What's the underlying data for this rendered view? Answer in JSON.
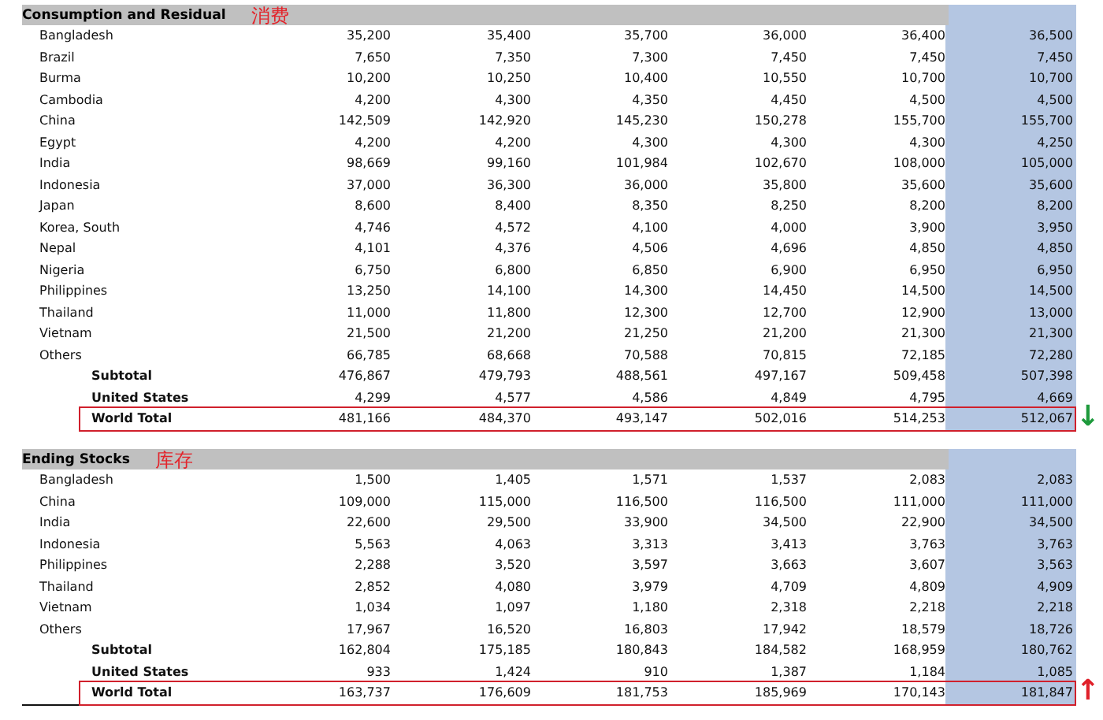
{
  "columns": [
    {
      "shaded": false
    },
    {
      "shaded": false
    },
    {
      "shaded": false
    },
    {
      "shaded": false
    },
    {
      "shaded": false
    },
    {
      "shaded": true
    }
  ],
  "sections": [
    {
      "title": "Consumption and Residual",
      "annotation": "消费",
      "arrow": {
        "glyph": "↓",
        "color": "#1e9a3c"
      },
      "rows": [
        {
          "kind": "country",
          "name": "Bangladesh",
          "boxed": false,
          "values": [
            "35,200",
            "35,400",
            "35,700",
            "36,000",
            "36,400",
            "36,500"
          ]
        },
        {
          "kind": "country",
          "name": "Brazil",
          "boxed": false,
          "values": [
            "7,650",
            "7,350",
            "7,300",
            "7,450",
            "7,450",
            "7,450"
          ]
        },
        {
          "kind": "country",
          "name": "Burma",
          "boxed": false,
          "values": [
            "10,200",
            "10,250",
            "10,400",
            "10,550",
            "10,700",
            "10,700"
          ]
        },
        {
          "kind": "country",
          "name": "Cambodia",
          "boxed": false,
          "values": [
            "4,200",
            "4,300",
            "4,350",
            "4,450",
            "4,500",
            "4,500"
          ]
        },
        {
          "kind": "country",
          "name": "China",
          "boxed": false,
          "values": [
            "142,509",
            "142,920",
            "145,230",
            "150,278",
            "155,700",
            "155,700"
          ]
        },
        {
          "kind": "country",
          "name": "Egypt",
          "boxed": false,
          "values": [
            "4,200",
            "4,200",
            "4,300",
            "4,300",
            "4,300",
            "4,250"
          ]
        },
        {
          "kind": "country",
          "name": "India",
          "boxed": false,
          "values": [
            "98,669",
            "99,160",
            "101,984",
            "102,670",
            "108,000",
            "105,000"
          ]
        },
        {
          "kind": "country",
          "name": "Indonesia",
          "boxed": false,
          "values": [
            "37,000",
            "36,300",
            "36,000",
            "35,800",
            "35,600",
            "35,600"
          ]
        },
        {
          "kind": "country",
          "name": "Japan",
          "boxed": false,
          "values": [
            "8,600",
            "8,400",
            "8,350",
            "8,250",
            "8,200",
            "8,200"
          ]
        },
        {
          "kind": "country",
          "name": "Korea, South",
          "boxed": false,
          "values": [
            "4,746",
            "4,572",
            "4,100",
            "4,000",
            "3,900",
            "3,950"
          ]
        },
        {
          "kind": "country",
          "name": "Nepal",
          "boxed": false,
          "values": [
            "4,101",
            "4,376",
            "4,506",
            "4,696",
            "4,850",
            "4,850"
          ]
        },
        {
          "kind": "country",
          "name": "Nigeria",
          "boxed": false,
          "values": [
            "6,750",
            "6,800",
            "6,850",
            "6,900",
            "6,950",
            "6,950"
          ]
        },
        {
          "kind": "country",
          "name": "Philippines",
          "boxed": false,
          "values": [
            "13,250",
            "14,100",
            "14,300",
            "14,450",
            "14,500",
            "14,500"
          ]
        },
        {
          "kind": "country",
          "name": "Thailand",
          "boxed": false,
          "values": [
            "11,000",
            "11,800",
            "12,300",
            "12,700",
            "12,900",
            "13,000"
          ]
        },
        {
          "kind": "country",
          "name": "Vietnam",
          "boxed": false,
          "values": [
            "21,500",
            "21,200",
            "21,250",
            "21,200",
            "21,300",
            "21,300"
          ]
        },
        {
          "kind": "country",
          "name": "Others",
          "boxed": false,
          "values": [
            "66,785",
            "68,668",
            "70,588",
            "70,815",
            "72,185",
            "72,280"
          ]
        },
        {
          "kind": "total",
          "name": "Subtotal",
          "boxed": false,
          "values": [
            "476,867",
            "479,793",
            "488,561",
            "497,167",
            "509,458",
            "507,398"
          ]
        },
        {
          "kind": "total",
          "name": "United States",
          "boxed": false,
          "values": [
            "4,299",
            "4,577",
            "4,586",
            "4,849",
            "4,795",
            "4,669"
          ]
        },
        {
          "kind": "total",
          "name": "World Total",
          "boxed": true,
          "values": [
            "481,166",
            "484,370",
            "493,147",
            "502,016",
            "514,253",
            "512,067"
          ]
        }
      ]
    },
    {
      "title": "Ending Stocks",
      "annotation": "库存",
      "arrow": {
        "glyph": "↑",
        "color": "#e0202a"
      },
      "rows": [
        {
          "kind": "country",
          "name": "Bangladesh",
          "boxed": false,
          "values": [
            "1,500",
            "1,405",
            "1,571",
            "1,537",
            "2,083",
            "2,083"
          ]
        },
        {
          "kind": "country",
          "name": "China",
          "boxed": false,
          "values": [
            "109,000",
            "115,000",
            "116,500",
            "116,500",
            "111,000",
            "111,000"
          ]
        },
        {
          "kind": "country",
          "name": "India",
          "boxed": false,
          "values": [
            "22,600",
            "29,500",
            "33,900",
            "34,500",
            "22,900",
            "34,500"
          ]
        },
        {
          "kind": "country",
          "name": "Indonesia",
          "boxed": false,
          "values": [
            "5,563",
            "4,063",
            "3,313",
            "3,413",
            "3,763",
            "3,763"
          ]
        },
        {
          "kind": "country",
          "name": "Philippines",
          "boxed": false,
          "values": [
            "2,288",
            "3,520",
            "3,597",
            "3,663",
            "3,607",
            "3,563"
          ]
        },
        {
          "kind": "country",
          "name": "Thailand",
          "boxed": false,
          "values": [
            "2,852",
            "4,080",
            "3,979",
            "4,709",
            "4,809",
            "4,909"
          ]
        },
        {
          "kind": "country",
          "name": "Vietnam",
          "boxed": false,
          "values": [
            "1,034",
            "1,097",
            "1,180",
            "2,318",
            "2,218",
            "2,218"
          ]
        },
        {
          "kind": "country",
          "name": "Others",
          "boxed": false,
          "values": [
            "17,967",
            "16,520",
            "16,803",
            "17,942",
            "18,579",
            "18,726"
          ]
        },
        {
          "kind": "total",
          "name": "Subtotal",
          "boxed": false,
          "values": [
            "162,804",
            "175,185",
            "180,843",
            "184,582",
            "168,959",
            "180,762"
          ]
        },
        {
          "kind": "total",
          "name": "United States",
          "boxed": false,
          "values": [
            "933",
            "1,424",
            "910",
            "1,387",
            "1,184",
            "1,085"
          ]
        },
        {
          "kind": "total",
          "name": "World Total",
          "boxed": true,
          "values": [
            "163,737",
            "176,609",
            "181,753",
            "185,969",
            "170,143",
            "181,847"
          ]
        }
      ]
    }
  ]
}
